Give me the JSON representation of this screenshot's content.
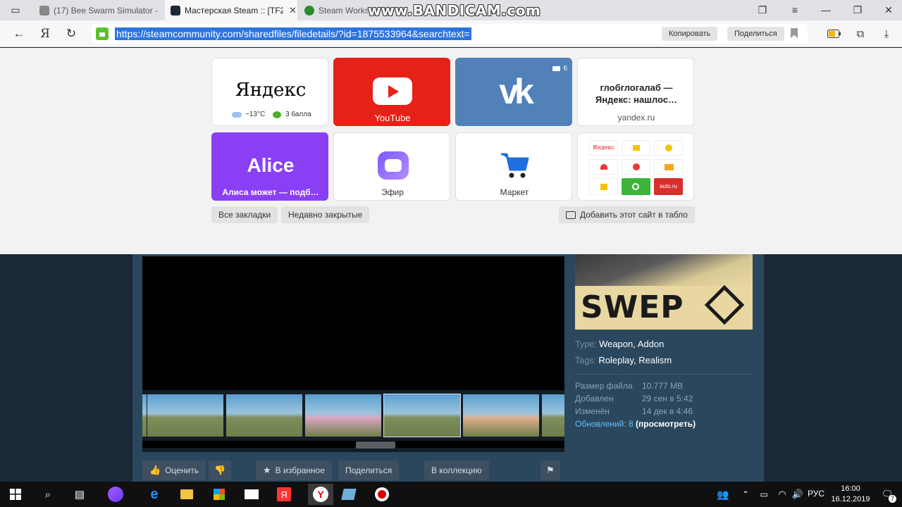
{
  "tabs": [
    {
      "title": "(17) Bee Swarm Simulator -"
    },
    {
      "title": "Мастерская Steam :: [TF2"
    },
    {
      "title": "Steam Works"
    }
  ],
  "watermark": "www.BANDICAM.com",
  "address_bar": {
    "url": "https://steamcommunity.com/sharedfiles/filedetails/?id=1875533964&searchtext=",
    "copy_label": "Копировать",
    "share_label": "Поделиться"
  },
  "tablo": {
    "yandex": {
      "logo": "Яндекс",
      "weather": "−13°C",
      "traffic": "3 балла"
    },
    "youtube": {
      "label": "YouTube"
    },
    "vk": {
      "mail_count": "6"
    },
    "search": {
      "title": "глобглогалаб — Яндекс: нашлос…",
      "domain": "yandex.ru"
    },
    "alice": {
      "title": "Alice",
      "subtitle": "Алиса может — подб…"
    },
    "efir": {
      "label": "Эфир"
    },
    "market": {
      "label": "Маркет"
    },
    "mini": {
      "yandex": "Яндекс",
      "auto": "auto.ru"
    },
    "all_bookmarks": "Все закладки",
    "recently_closed": "Недавно закрытые",
    "add_site": "Добавить этот сайт в табло"
  },
  "steam": {
    "banner_text": "SWEP",
    "type_label": "Type:",
    "type_value_1": "Weapon",
    "type_value_2": "Addon",
    "tags_label": "Tags:",
    "tags_value_1": "Roleplay",
    "tags_value_2": "Realism",
    "stats": [
      {
        "label": "Размер файла",
        "value": "10.777 MB"
      },
      {
        "label": "Добавлен",
        "value": "29 сен в 5:42"
      },
      {
        "label": "Изменён",
        "value": "14 дек в 4:46"
      }
    ],
    "updates_label": "Обновлений: 8",
    "updates_link": "(просмотреть)",
    "actions": {
      "rate": "Оценить",
      "favorite": "В избранное",
      "share": "Поделиться",
      "collection": "В коллекцию"
    }
  },
  "taskbar": {
    "lang": "РУС",
    "time": "16:00",
    "date": "16.12.2019",
    "notif_count": "7"
  }
}
